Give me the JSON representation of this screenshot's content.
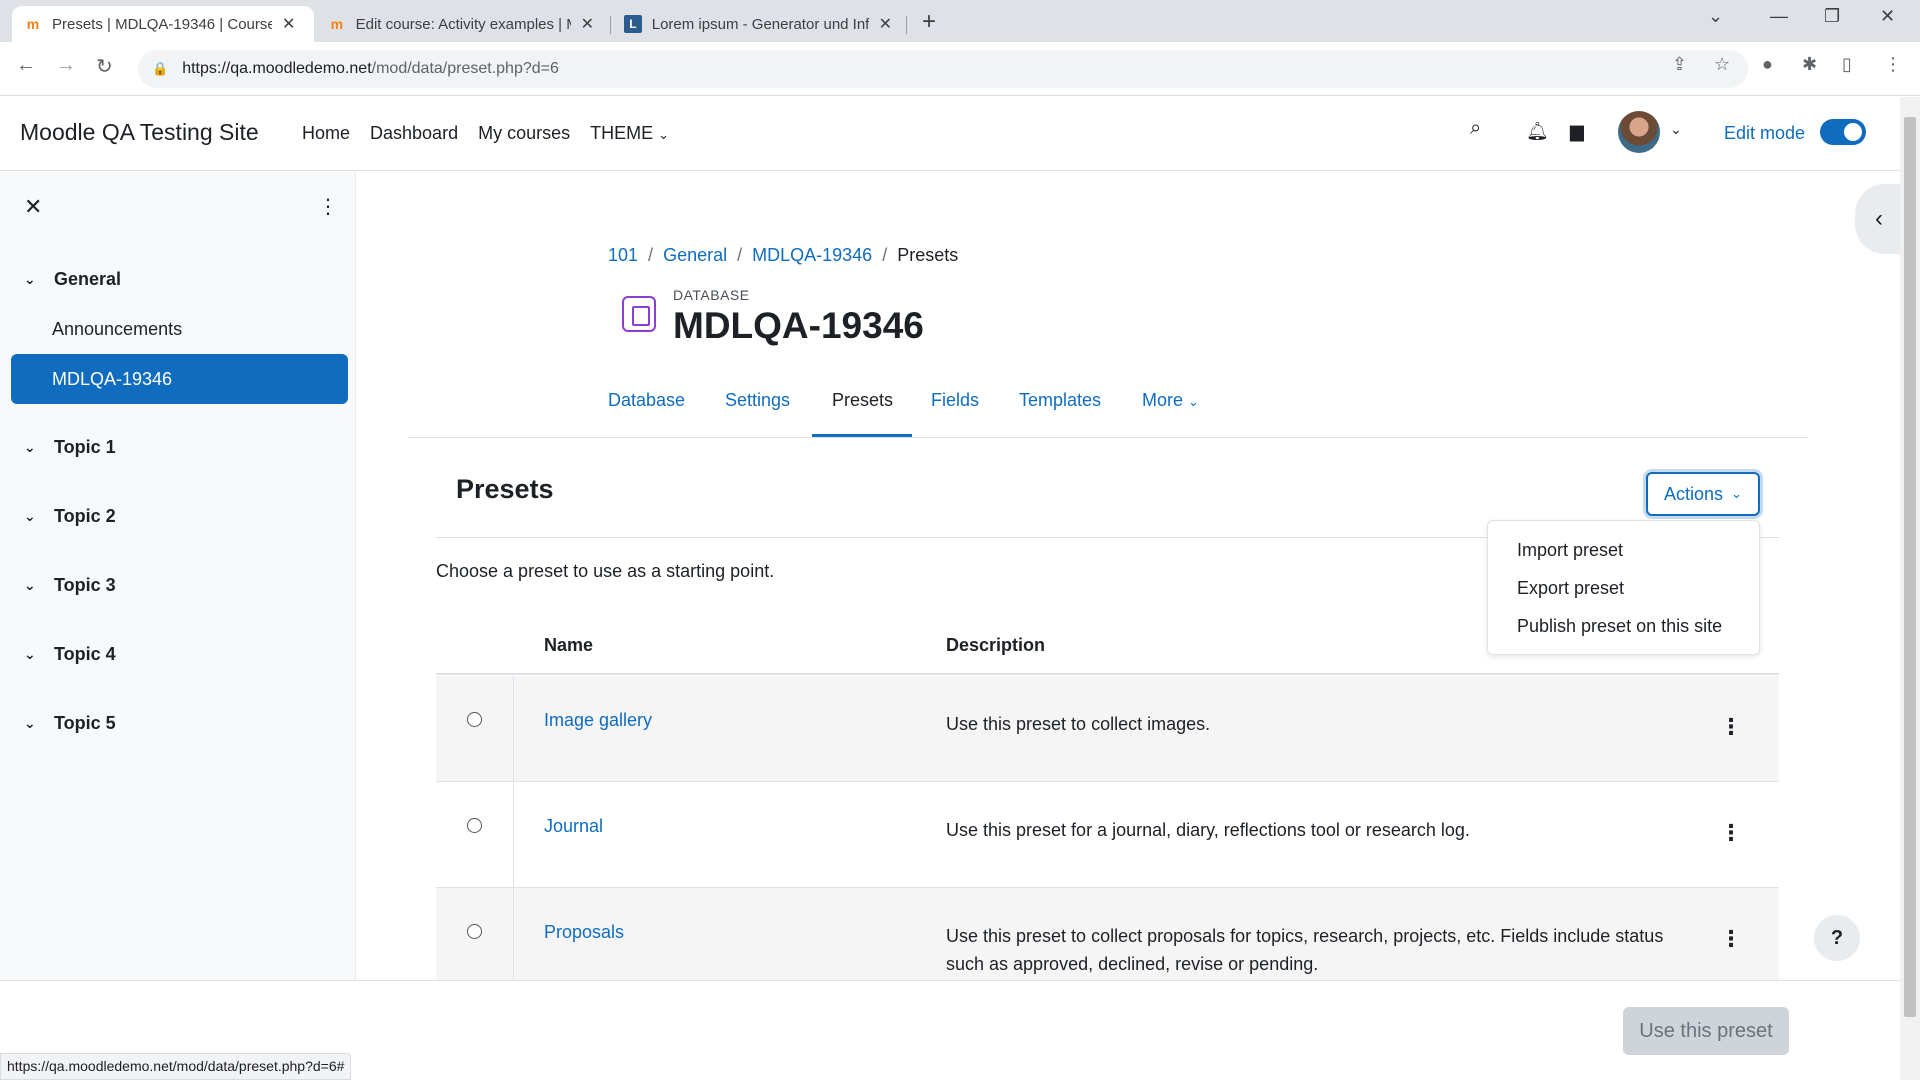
{
  "browser": {
    "tabs": [
      {
        "title": "Presets | MDLQA-19346 | Course",
        "favicon": "moodle-icon"
      },
      {
        "title": "Edit course: Activity examples | M",
        "favicon": "moodle-icon"
      },
      {
        "title": "Lorem ipsum - Generator und Inf",
        "favicon": "lorem-icon"
      }
    ],
    "url_host": "https://qa.moodledemo.net",
    "url_path": "/mod/data/preset.php?d=6",
    "status_url": "https://qa.moodledemo.net/mod/data/preset.php?d=6#"
  },
  "navbar": {
    "brand": "Moodle QA Testing Site",
    "items": [
      "Home",
      "Dashboard",
      "My courses",
      "THEME"
    ],
    "edit_mode_label": "Edit mode",
    "edit_mode_on": true
  },
  "drawer": {
    "sections": [
      {
        "title": "General",
        "activities": [
          "Announcements",
          "MDLQA-19346"
        ]
      },
      {
        "title": "Topic 1"
      },
      {
        "title": "Topic 2"
      },
      {
        "title": "Topic 3"
      },
      {
        "title": "Topic 4"
      },
      {
        "title": "Topic 5"
      }
    ],
    "active_activity": "MDLQA-19346"
  },
  "breadcrumb": [
    "101",
    "General",
    "MDLQA-19346",
    "Presets"
  ],
  "module": {
    "type_label": "DATABASE",
    "title": "MDLQA-19346"
  },
  "secondary_nav": {
    "tabs": [
      "Database",
      "Settings",
      "Presets",
      "Fields",
      "Templates",
      "More"
    ],
    "active": "Presets"
  },
  "page": {
    "heading": "Presets",
    "actions_label": "Actions",
    "actions_menu": [
      "Import preset",
      "Export preset",
      "Publish preset on this site"
    ],
    "intro": "Choose a preset to use as a starting point."
  },
  "table": {
    "columns": [
      "Name",
      "Description"
    ],
    "rows": [
      {
        "name": "Image gallery",
        "description": "Use this preset to collect images."
      },
      {
        "name": "Journal",
        "description": "Use this preset for a journal, diary, reflections tool or research log."
      },
      {
        "name": "Proposals",
        "description": "Use this preset to collect proposals for topics, research, projects, etc. Fields include status such as approved, declined, revise or pending."
      }
    ]
  },
  "footer": {
    "use_preset_label": "Use this preset",
    "help_label": "?"
  },
  "colors": {
    "primary": "#0f6cbf",
    "database_icon": "#8d3cd6"
  }
}
